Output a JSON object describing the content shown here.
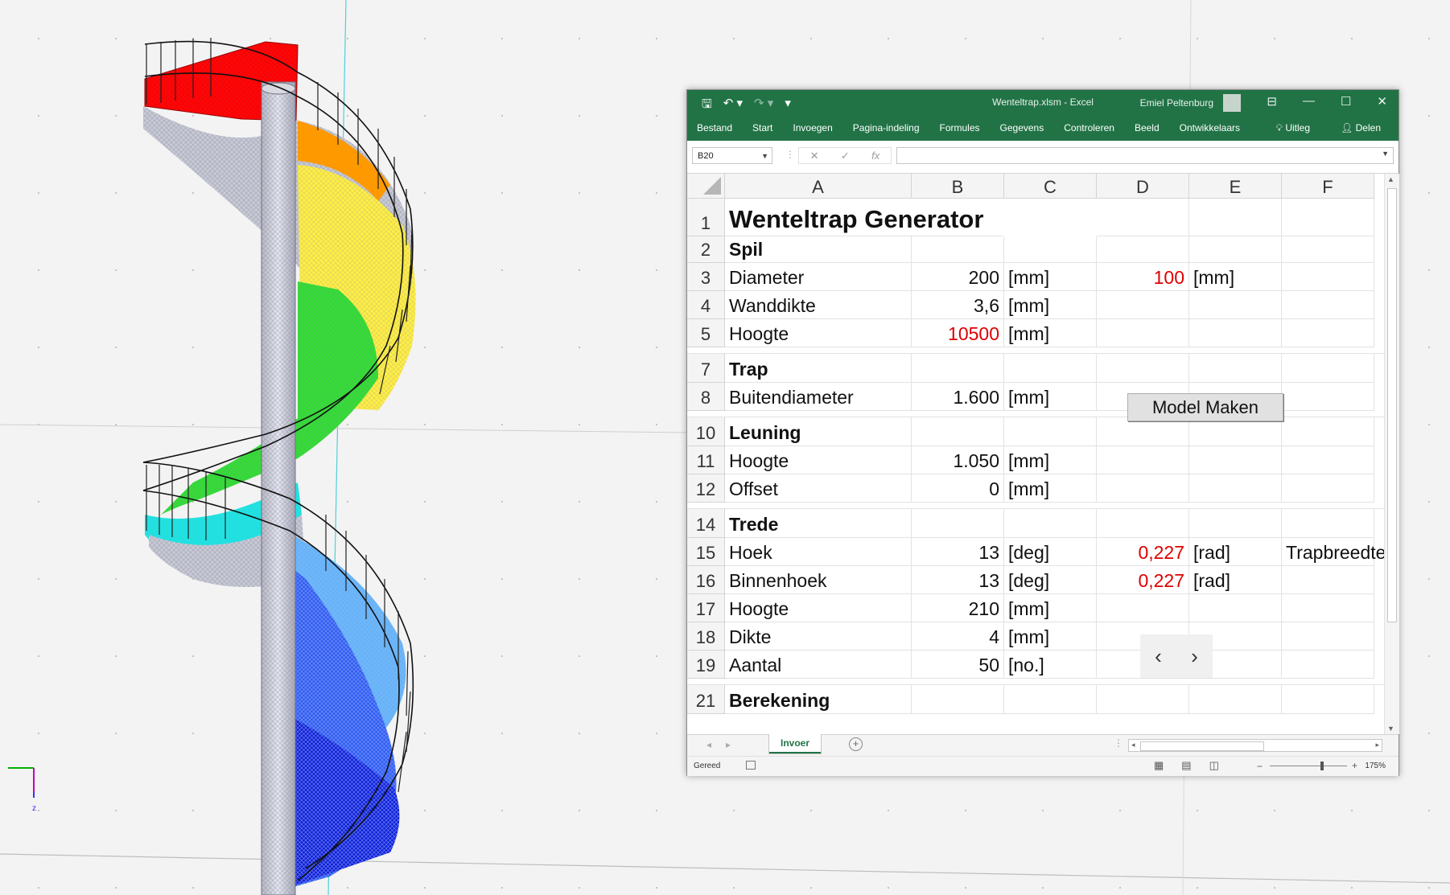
{
  "excel": {
    "title": "Wenteltrap.xlsm  -  Excel",
    "user": "Emiel Peltenburg",
    "ribbon_tabs": [
      "Bestand",
      "Start",
      "Invoegen",
      "Pagina-indeling",
      "Formules",
      "Gegevens",
      "Controleren",
      "Beeld",
      "Ontwikkelaars"
    ],
    "help_label": "Uitleg",
    "share_label": "Delen",
    "name_box": "B20",
    "formula_value": "",
    "columns": [
      "A",
      "B",
      "C",
      "D",
      "E",
      "F"
    ],
    "rows": [
      {
        "n": "1",
        "a": "Wenteltrap Generator"
      },
      {
        "n": "2",
        "a": "Spil"
      },
      {
        "n": "3",
        "a": "Diameter",
        "b": "200",
        "c": "[mm]",
        "d": "100",
        "e": "[mm]"
      },
      {
        "n": "4",
        "a": "Wanddikte",
        "b": "3,6",
        "c": "[mm]"
      },
      {
        "n": "5",
        "a": "Hoogte",
        "b": "10500",
        "c": "[mm]"
      },
      {
        "n": "7",
        "a": "Trap"
      },
      {
        "n": "8",
        "a": "Buitendiameter",
        "b": "1.600",
        "c": "[mm]"
      },
      {
        "n": "10",
        "a": "Leuning"
      },
      {
        "n": "11",
        "a": "Hoogte",
        "b": "1.050",
        "c": "[mm]"
      },
      {
        "n": "12",
        "a": "Offset",
        "b": "0",
        "c": "[mm]"
      },
      {
        "n": "14",
        "a": "Trede"
      },
      {
        "n": "15",
        "a": "Hoek",
        "b": "13",
        "c": "[deg]",
        "d": "0,227",
        "e": "[rad]",
        "f": "Trapbreedte"
      },
      {
        "n": "16",
        "a": "Binnenhoek",
        "b": "13",
        "c": "[deg]",
        "d": "0,227",
        "e": "[rad]"
      },
      {
        "n": "17",
        "a": "Hoogte",
        "b": "210",
        "c": "[mm]"
      },
      {
        "n": "18",
        "a": "Dikte",
        "b": "4",
        "c": "[mm]"
      },
      {
        "n": "19",
        "a": "Aantal",
        "b": "50",
        "c": "[no.]"
      },
      {
        "n": "21",
        "a": "Berekening"
      }
    ],
    "model_button": "Model Maken",
    "nav_prev": "‹",
    "nav_next": "›",
    "sheet_tab": "Invoer",
    "status_ready": "Gereed",
    "zoom_minus": "−",
    "zoom_plus": "+",
    "zoom": "175%"
  },
  "viewport": {
    "axis_label": "z",
    "colors": {
      "top_flight": "#ff0000",
      "upper_flights": [
        "#ff9900",
        "#ffee33",
        "#33dd33"
      ],
      "mid_flight": "#22e0e0",
      "lower_flights": [
        "#2288ee",
        "#1133ee",
        "#0000cc"
      ],
      "mesh": "#aab0c0",
      "railing": "#222222",
      "accent_red": "#d00000"
    }
  }
}
